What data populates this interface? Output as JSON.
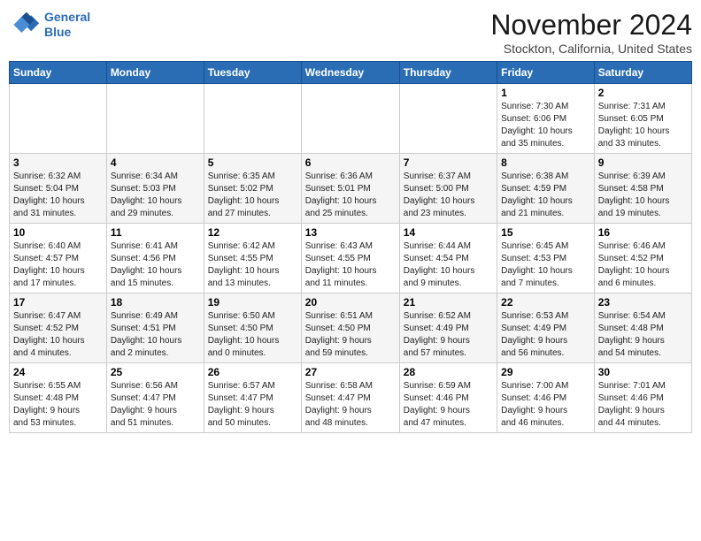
{
  "header": {
    "logo_line1": "General",
    "logo_line2": "Blue",
    "month_title": "November 2024",
    "location": "Stockton, California, United States"
  },
  "weekdays": [
    "Sunday",
    "Monday",
    "Tuesday",
    "Wednesday",
    "Thursday",
    "Friday",
    "Saturday"
  ],
  "weeks": [
    [
      {
        "day": "",
        "info": ""
      },
      {
        "day": "",
        "info": ""
      },
      {
        "day": "",
        "info": ""
      },
      {
        "day": "",
        "info": ""
      },
      {
        "day": "",
        "info": ""
      },
      {
        "day": "1",
        "info": "Sunrise: 7:30 AM\nSunset: 6:06 PM\nDaylight: 10 hours\nand 35 minutes."
      },
      {
        "day": "2",
        "info": "Sunrise: 7:31 AM\nSunset: 6:05 PM\nDaylight: 10 hours\nand 33 minutes."
      }
    ],
    [
      {
        "day": "3",
        "info": "Sunrise: 6:32 AM\nSunset: 5:04 PM\nDaylight: 10 hours\nand 31 minutes."
      },
      {
        "day": "4",
        "info": "Sunrise: 6:34 AM\nSunset: 5:03 PM\nDaylight: 10 hours\nand 29 minutes."
      },
      {
        "day": "5",
        "info": "Sunrise: 6:35 AM\nSunset: 5:02 PM\nDaylight: 10 hours\nand 27 minutes."
      },
      {
        "day": "6",
        "info": "Sunrise: 6:36 AM\nSunset: 5:01 PM\nDaylight: 10 hours\nand 25 minutes."
      },
      {
        "day": "7",
        "info": "Sunrise: 6:37 AM\nSunset: 5:00 PM\nDaylight: 10 hours\nand 23 minutes."
      },
      {
        "day": "8",
        "info": "Sunrise: 6:38 AM\nSunset: 4:59 PM\nDaylight: 10 hours\nand 21 minutes."
      },
      {
        "day": "9",
        "info": "Sunrise: 6:39 AM\nSunset: 4:58 PM\nDaylight: 10 hours\nand 19 minutes."
      }
    ],
    [
      {
        "day": "10",
        "info": "Sunrise: 6:40 AM\nSunset: 4:57 PM\nDaylight: 10 hours\nand 17 minutes."
      },
      {
        "day": "11",
        "info": "Sunrise: 6:41 AM\nSunset: 4:56 PM\nDaylight: 10 hours\nand 15 minutes."
      },
      {
        "day": "12",
        "info": "Sunrise: 6:42 AM\nSunset: 4:55 PM\nDaylight: 10 hours\nand 13 minutes."
      },
      {
        "day": "13",
        "info": "Sunrise: 6:43 AM\nSunset: 4:55 PM\nDaylight: 10 hours\nand 11 minutes."
      },
      {
        "day": "14",
        "info": "Sunrise: 6:44 AM\nSunset: 4:54 PM\nDaylight: 10 hours\nand 9 minutes."
      },
      {
        "day": "15",
        "info": "Sunrise: 6:45 AM\nSunset: 4:53 PM\nDaylight: 10 hours\nand 7 minutes."
      },
      {
        "day": "16",
        "info": "Sunrise: 6:46 AM\nSunset: 4:52 PM\nDaylight: 10 hours\nand 6 minutes."
      }
    ],
    [
      {
        "day": "17",
        "info": "Sunrise: 6:47 AM\nSunset: 4:52 PM\nDaylight: 10 hours\nand 4 minutes."
      },
      {
        "day": "18",
        "info": "Sunrise: 6:49 AM\nSunset: 4:51 PM\nDaylight: 10 hours\nand 2 minutes."
      },
      {
        "day": "19",
        "info": "Sunrise: 6:50 AM\nSunset: 4:50 PM\nDaylight: 10 hours\nand 0 minutes."
      },
      {
        "day": "20",
        "info": "Sunrise: 6:51 AM\nSunset: 4:50 PM\nDaylight: 9 hours\nand 59 minutes."
      },
      {
        "day": "21",
        "info": "Sunrise: 6:52 AM\nSunset: 4:49 PM\nDaylight: 9 hours\nand 57 minutes."
      },
      {
        "day": "22",
        "info": "Sunrise: 6:53 AM\nSunset: 4:49 PM\nDaylight: 9 hours\nand 56 minutes."
      },
      {
        "day": "23",
        "info": "Sunrise: 6:54 AM\nSunset: 4:48 PM\nDaylight: 9 hours\nand 54 minutes."
      }
    ],
    [
      {
        "day": "24",
        "info": "Sunrise: 6:55 AM\nSunset: 4:48 PM\nDaylight: 9 hours\nand 53 minutes."
      },
      {
        "day": "25",
        "info": "Sunrise: 6:56 AM\nSunset: 4:47 PM\nDaylight: 9 hours\nand 51 minutes."
      },
      {
        "day": "26",
        "info": "Sunrise: 6:57 AM\nSunset: 4:47 PM\nDaylight: 9 hours\nand 50 minutes."
      },
      {
        "day": "27",
        "info": "Sunrise: 6:58 AM\nSunset: 4:47 PM\nDaylight: 9 hours\nand 48 minutes."
      },
      {
        "day": "28",
        "info": "Sunrise: 6:59 AM\nSunset: 4:46 PM\nDaylight: 9 hours\nand 47 minutes."
      },
      {
        "day": "29",
        "info": "Sunrise: 7:00 AM\nSunset: 4:46 PM\nDaylight: 9 hours\nand 46 minutes."
      },
      {
        "day": "30",
        "info": "Sunrise: 7:01 AM\nSunset: 4:46 PM\nDaylight: 9 hours\nand 44 minutes."
      }
    ]
  ]
}
